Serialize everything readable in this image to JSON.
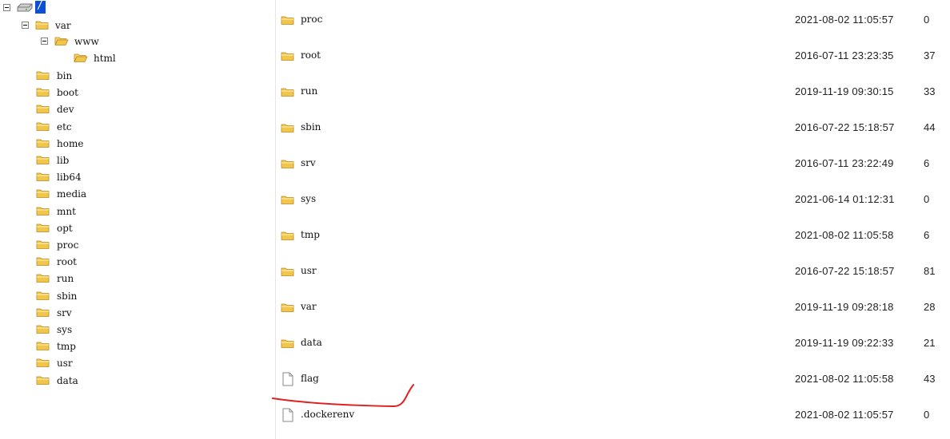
{
  "tree": {
    "root": "/",
    "var": "var",
    "www": "www",
    "html": "html",
    "top_dirs": [
      "bin",
      "boot",
      "dev",
      "etc",
      "home",
      "lib",
      "lib64",
      "media",
      "mnt",
      "opt",
      "proc",
      "root",
      "run",
      "sbin",
      "srv",
      "sys",
      "tmp",
      "usr",
      "data"
    ]
  },
  "files": [
    {
      "name": "proc",
      "date": "2021-08-02 11:05:57",
      "perm": "0",
      "type": "folder"
    },
    {
      "name": "root",
      "date": "2016-07-11 23:23:35",
      "perm": "37",
      "type": "folder"
    },
    {
      "name": "run",
      "date": "2019-11-19 09:30:15",
      "perm": "33",
      "type": "folder"
    },
    {
      "name": "sbin",
      "date": "2016-07-22 15:18:57",
      "perm": "44",
      "type": "folder"
    },
    {
      "name": "srv",
      "date": "2016-07-11 23:22:49",
      "perm": "6",
      "type": "folder"
    },
    {
      "name": "sys",
      "date": "2021-06-14 01:12:31",
      "perm": "0",
      "type": "folder"
    },
    {
      "name": "tmp",
      "date": "2021-08-02 11:05:58",
      "perm": "6",
      "type": "folder"
    },
    {
      "name": "usr",
      "date": "2016-07-22 15:18:57",
      "perm": "81",
      "type": "folder"
    },
    {
      "name": "var",
      "date": "2019-11-19 09:28:18",
      "perm": "28",
      "type": "folder"
    },
    {
      "name": "data",
      "date": "2019-11-19 09:22:33",
      "perm": "21",
      "type": "folder"
    },
    {
      "name": "flag",
      "date": "2021-08-02 11:05:58",
      "perm": "43",
      "type": "file"
    },
    {
      "name": ".dockerenv",
      "date": "2021-08-02 11:05:57",
      "perm": "0",
      "type": "file"
    }
  ],
  "colors": {
    "folder": "#f2c64a",
    "folder_dark": "#c9962a",
    "selection": "#0a4fd6",
    "annotation": "#e02020"
  }
}
